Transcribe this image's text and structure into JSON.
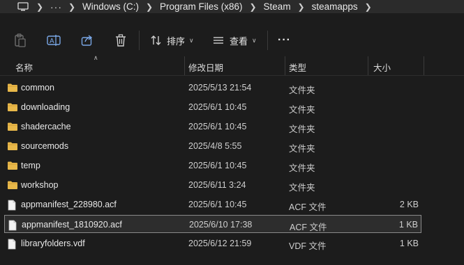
{
  "breadcrumb": {
    "icon": "monitor-icon",
    "more": "···",
    "segments": [
      "Windows (C:)",
      "Program Files (x86)",
      "Steam",
      "steamapps"
    ]
  },
  "toolbar": {
    "sort_label": "排序",
    "view_label": "查看",
    "more": "···"
  },
  "columns": {
    "name": "名称",
    "modified": "修改日期",
    "type": "类型",
    "size": "大小"
  },
  "files": [
    {
      "name": "common",
      "modified": "2025/5/13 21:54",
      "type": "文件夹",
      "size": "",
      "kind": "folder"
    },
    {
      "name": "downloading",
      "modified": "2025/6/1 10:45",
      "type": "文件夹",
      "size": "",
      "kind": "folder"
    },
    {
      "name": "shadercache",
      "modified": "2025/6/1 10:45",
      "type": "文件夹",
      "size": "",
      "kind": "folder"
    },
    {
      "name": "sourcemods",
      "modified": "2025/4/8 5:55",
      "type": "文件夹",
      "size": "",
      "kind": "folder"
    },
    {
      "name": "temp",
      "modified": "2025/6/1 10:45",
      "type": "文件夹",
      "size": "",
      "kind": "folder"
    },
    {
      "name": "workshop",
      "modified": "2025/6/11 3:24",
      "type": "文件夹",
      "size": "",
      "kind": "folder"
    },
    {
      "name": "appmanifest_228980.acf",
      "modified": "2025/6/1 10:45",
      "type": "ACF 文件",
      "size": "2 KB",
      "kind": "file"
    },
    {
      "name": "appmanifest_1810920.acf",
      "modified": "2025/6/10 17:38",
      "type": "ACF 文件",
      "size": "1 KB",
      "kind": "file",
      "selected": true
    },
    {
      "name": "libraryfolders.vdf",
      "modified": "2025/6/12 21:59",
      "type": "VDF 文件",
      "size": "1 KB",
      "kind": "file"
    }
  ],
  "colors": {
    "folder": "#e8b84a",
    "background": "#1c1c1c",
    "selection_border": "#8a8a8a"
  }
}
